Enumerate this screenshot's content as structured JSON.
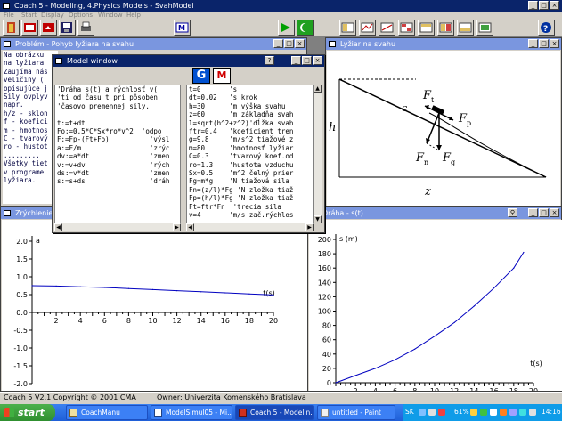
{
  "app": {
    "title": "Coach 5 - Modeling,  4.Physics Models - SvahModel",
    "menu": [
      "File",
      "Start",
      "Display",
      "Options",
      "Window",
      "Help"
    ],
    "help_label": "?"
  },
  "problem_window": {
    "title": "Problém - Pohyb lyžiara na svahu",
    "lines": [
      "Na obrázku",
      "na lyžiara",
      "Zaujíma nás",
      "veličiny (",
      "opisujúce j",
      "Sily ovplyv",
      "napr.",
      "h/z - sklon",
      "f - koefici",
      "m - hmotnos",
      "C - tvarový",
      "ro - hustot",
      ".........",
      "Všetky tiet",
      "v programe",
      "lyžiara."
    ]
  },
  "model_window": {
    "title": "Model window",
    "btn_g": "G",
    "btn_m": "M",
    "left_lines": [
      "'Dráha s(t) a rýchlosť v(",
      "'ti od času t pri pôsoben",
      "'časovo premennej sily.",
      "",
      "t:=t+dt",
      "Fo:=0.5*C*Sx*ro*v^2  'odpo",
      "F:=Fp-(Ft+Fo)          'výsl",
      "a:=F/m                 'zrýc",
      "dv:=a*dt               'zmen",
      "v:=v+dv                'rých",
      "ds:=v*dt               'zmen",
      "s:=s+ds                'dráh"
    ],
    "right_lines": [
      "t=0       's",
      "dt=0.02   's krok",
      "h=30      'm výška svahu",
      "z=60      'm základňa svah",
      "l=sqrt(h^2+z^2)'dĺžka svah",
      "ftr=0.4   'koeficient tren",
      "g=9.8     'm/s^2 tiažové z",
      "m=80      'hmotnosť lyžiar",
      "C=0.3     'tvarový koef.od",
      "ro=1.3    'hustota vzduchu",
      "Sx=0.5    'm^2 čelný prier",
      "Fg=m*g    'N tiažová sila",
      "Fn=(z/l)*Fg 'N zložka tiaž",
      "Fp=(h/l)*Fg 'N zložka tiaž",
      "Ft=ftr*Fn  'trecia sila",
      "v=4       'm/s zač.rýchlos"
    ]
  },
  "diagram_window": {
    "title": "Lyžiar na svahu",
    "labels": {
      "h": "h",
      "z": "z",
      "c": "c",
      "ft": "F",
      "ft_sub": "t",
      "fp": "F",
      "fp_sub": "p",
      "fn": "F",
      "fn_sub": "n",
      "fg": "F",
      "fg_sub": "g"
    }
  },
  "accel_window": {
    "title": "Zrýchlenie",
    "y_label": "a",
    "x_label": "t(s)"
  },
  "path_window": {
    "title": "Dráha - s(t)",
    "y_label": "s (m)",
    "x_label": "t(s)"
  },
  "status_bar": {
    "version": "Coach 5 V2.1 Copyright © 2001 CMA",
    "owner": "Owner: Univerzita Komenského Bratislava"
  },
  "taskbar": {
    "start": "start",
    "buttons": [
      "CoachManu",
      "ModelSimul05 - Mi...",
      "Coach 5 - Modelin...",
      "untitled - Paint"
    ],
    "lang": "SK",
    "battery": "61%",
    "time": "14:16"
  },
  "chart_data": [
    {
      "type": "line",
      "title": "",
      "xlabel": "t(s)",
      "ylabel": "a",
      "xlim": [
        0,
        20
      ],
      "ylim": [
        -2.0,
        2.0
      ],
      "x_ticks": [
        2,
        4,
        6,
        8,
        10,
        12,
        14,
        16,
        18,
        20
      ],
      "y_ticks": [
        2.0,
        1.5,
        1.0,
        0.5,
        0,
        -0.5,
        -1.0,
        -1.5,
        -2.0
      ],
      "x": [
        0,
        2,
        4,
        6,
        8,
        10,
        12,
        14,
        16,
        18,
        20
      ],
      "y": [
        0.75,
        0.74,
        0.72,
        0.7,
        0.67,
        0.64,
        0.61,
        0.58,
        0.55,
        0.52,
        0.49
      ],
      "color": "#0000c0",
      "grid": false
    },
    {
      "type": "line",
      "title": "",
      "xlabel": "t(s)",
      "ylabel": "s (m)",
      "xlim": [
        0,
        20
      ],
      "ylim": [
        0,
        200
      ],
      "x_ticks": [
        2,
        4,
        6,
        8,
        10,
        12,
        14,
        16,
        18,
        20
      ],
      "y_ticks": [
        0,
        20,
        40,
        60,
        80,
        100,
        120,
        140,
        160,
        180,
        200
      ],
      "x": [
        0,
        2,
        4,
        6,
        8,
        10,
        12,
        14,
        16,
        18,
        19
      ],
      "y": [
        0,
        10,
        20,
        32,
        47,
        65,
        84,
        107,
        132,
        160,
        182
      ],
      "color": "#0000c0",
      "grid": false
    }
  ]
}
